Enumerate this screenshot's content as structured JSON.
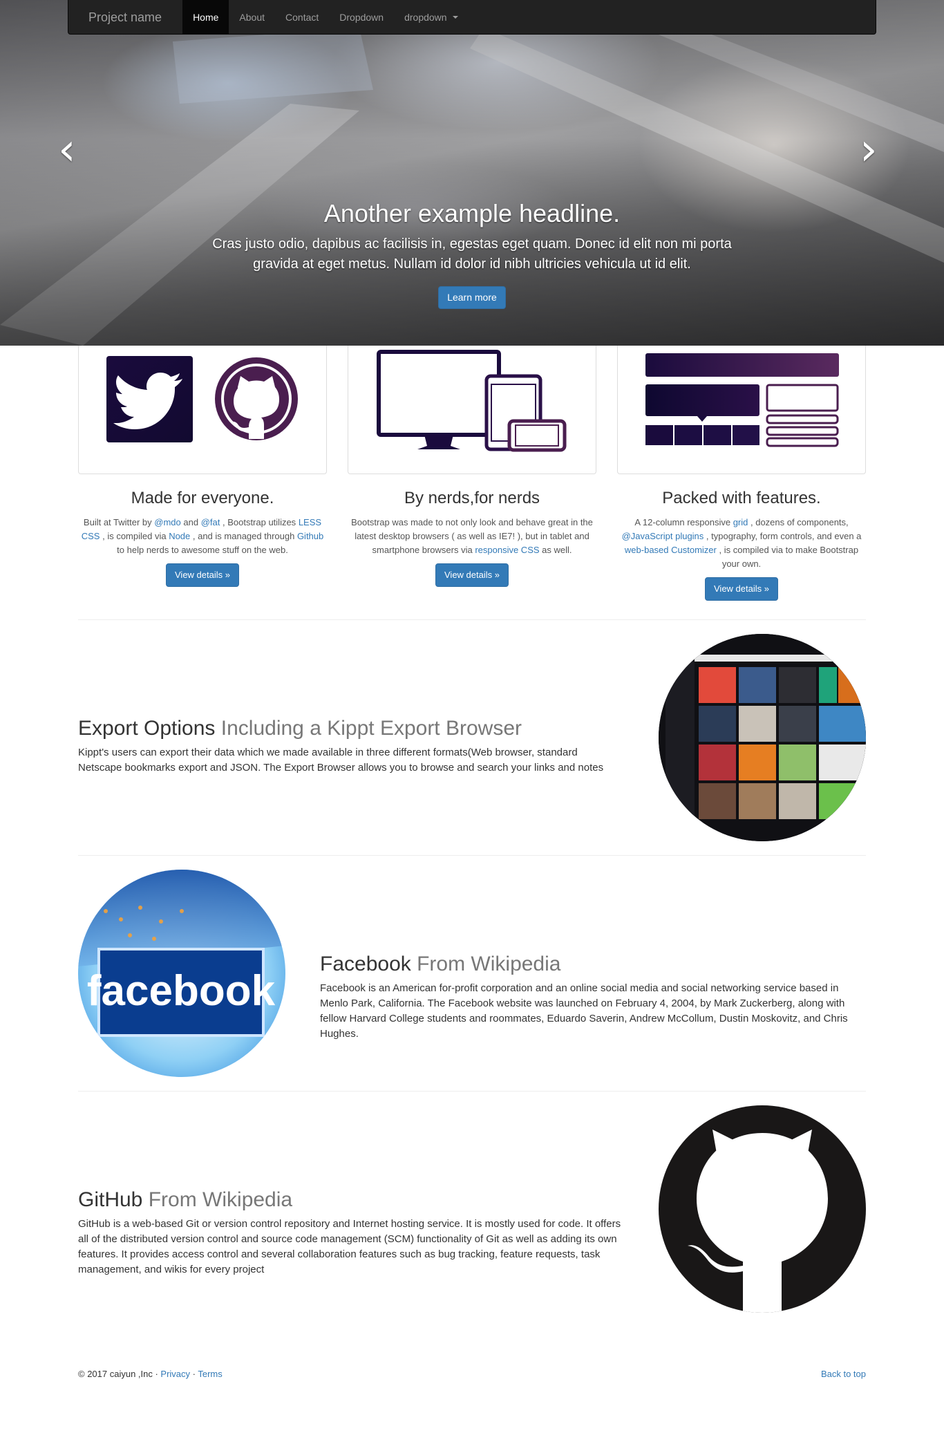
{
  "nav": {
    "brand": "Project name",
    "items": [
      {
        "label": "Home",
        "active": true
      },
      {
        "label": "About"
      },
      {
        "label": "Contact"
      },
      {
        "label": "Dropdown"
      },
      {
        "label": "dropdown",
        "caret": true
      }
    ]
  },
  "carousel": {
    "headline": "Another example headline.",
    "text_line1": "Cras justo odio, dapibus ac facilisis in, egestas eget quam. Donec id elit non mi porta",
    "text_line2": "gravida at eget metus. Nullam id dolor id nibh ultricies vehicula ut id elit.",
    "button": "Learn more",
    "prev_icon": "‹",
    "next_icon": "›"
  },
  "columns": [
    {
      "title": "Made for everyone.",
      "t1": "Built at Twitter by ",
      "l1": "@mdo",
      "t2": " and ",
      "l2": "@fat",
      "t3": " , Bootstrap utilizes ",
      "l3": "LESS CSS",
      "t4": " , is compiled via ",
      "l4": "Node",
      "t5": " , and is managed through ",
      "l5": "Github",
      "t6": " to help nerds to awesome stuff on the web.",
      "button": "View details »"
    },
    {
      "title": "By nerds,for nerds",
      "t1": "Bootstrap was made to not only look and behave great in the latest desktop browsers ( as well as IE7! ), but in tablet and smartphone browsers via ",
      "l1": "responsive CSS",
      "t2": " as well.",
      "button": "View details »"
    },
    {
      "title": "Packed with features.",
      "t1": "A 12-column responsive ",
      "l1": "grid",
      "t2": " , dozens of components, ",
      "l2": "@JavaScript plugins",
      "t3": " , typography, form controls, and even a ",
      "l3": "web-based Customizer",
      "t4": " , is compiled via to make Bootstrap your own.",
      "button": "View details »"
    }
  ],
  "featurettes": [
    {
      "heading": "Export Options",
      "muted": "Including a Kippt Export Browser",
      "text": "Kippt's users can export their data which we made available in three different formats(Web browser, standard Netscape bookmarks export and JSON. The Export Browser allows you to browse and search your links and notes"
    },
    {
      "heading": "Facebook",
      "muted": "From Wikipedia",
      "text": "Facebook is an American for-profit corporation and an online social media and social networking service based in Menlo Park, California. The Facebook website was launched on February 4, 2004, by Mark Zuckerberg, along with fellow Harvard College students and roommates, Eduardo Saverin, Andrew McCollum, Dustin Moskovitz, and Chris Hughes.",
      "logo_text": "facebook"
    },
    {
      "heading": "GitHub",
      "muted": "From Wikipedia",
      "text": "GitHub is a web-based Git or version control repository and Internet hosting service. It is mostly used for code. It offers all of the distributed version control and source code management (SCM) functionality of Git as well as adding its own features. It provides access control and several collaboration features such as bug tracking, feature requests, task management, and wikis for every project"
    }
  ],
  "footer": {
    "copyright": "© 2017 caiyun ,Inc · ",
    "privacy": "Privacy",
    "dot": " · ",
    "terms": "Terms",
    "back_to_top": "Back to top"
  },
  "colors": {
    "primary": "#337ab7",
    "navbar": "#222222",
    "brand_purple": "#1a0b3d"
  }
}
